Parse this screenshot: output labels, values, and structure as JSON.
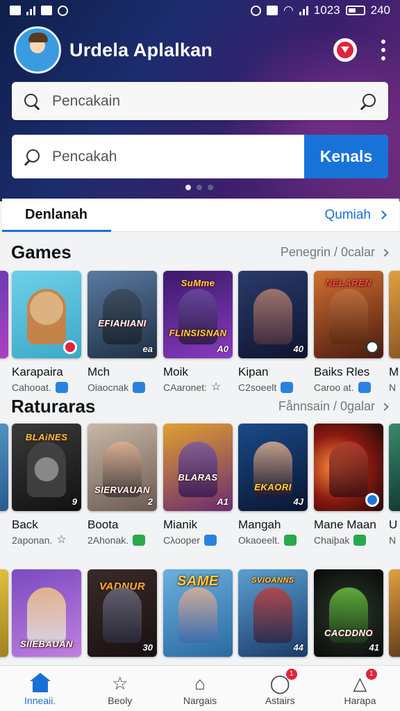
{
  "status": {
    "time": "240",
    "battery_text": "1023"
  },
  "header": {
    "title": "Urdela Aplalkan"
  },
  "search_primary": {
    "placeholder": "Pencakain"
  },
  "search_secondary": {
    "placeholder": "Pencakah",
    "button_label": "Kenals"
  },
  "tabs": {
    "active": "Denlanah",
    "link": "Qumiah"
  },
  "sections": [
    {
      "title": "Games",
      "more": "Penegrin / 0calar",
      "items": [
        {
          "name": "Karapaira",
          "meta": "Cahooat.",
          "cap": "",
          "badge": "",
          "icon": "blue"
        },
        {
          "name": "Mch",
          "meta": "Oiaocnak",
          "cap": "EFIAHIANI",
          "badge": "ea",
          "icon": "blue"
        },
        {
          "name": "Moik",
          "meta": "CAaronet:",
          "cap": "FLINSISNAN",
          "badge": "A0",
          "icon": "star",
          "title_top": "SuMme"
        },
        {
          "name": "Kipan",
          "meta": "C2soeelt",
          "cap": "",
          "badge": "40",
          "icon": "blue"
        },
        {
          "name": "Baiks Rles",
          "meta": "Caroo at.",
          "cap": "",
          "badge": "",
          "icon": "blue",
          "title_top": "NELAREN"
        }
      ],
      "partial_right": {
        "name": "M",
        "meta": "N"
      }
    },
    {
      "title": "Raturaras",
      "more": "Fånnsain / 0galar",
      "items": [
        {
          "name": "Back",
          "meta": "2aponan.",
          "cap": "",
          "badge": "9",
          "icon": "star",
          "title_top": "BLAiNES"
        },
        {
          "name": "Boota",
          "meta": "2Ahonak.",
          "cap": "SIERVAUAN",
          "badge": "2",
          "icon": "green"
        },
        {
          "name": "Mianik",
          "meta": "Cλooper",
          "cap": "BLARAS",
          "badge": "A1",
          "icon": "blue"
        },
        {
          "name": "Mangah",
          "meta": "Okaoeelt.",
          "cap": "EKAORI",
          "badge": "4J",
          "icon": "green"
        },
        {
          "name": "Mane Maan",
          "meta": "Chaiþak",
          "cap": "",
          "badge": "",
          "icon": "green"
        }
      ],
      "partial_right": {
        "name": "U",
        "meta": "N"
      }
    },
    {
      "items": [
        {
          "cap": "SIIEBAUAN",
          "badge": "",
          "title_top": ""
        },
        {
          "cap": "",
          "badge": "30",
          "title_top": "VADNUR"
        },
        {
          "cap": "",
          "badge": "",
          "title_top": "SAME"
        },
        {
          "cap": "",
          "badge": "44",
          "title_top": "SVIOANNS"
        },
        {
          "cap": "CACDDNO",
          "badge": "41",
          "title_top": ""
        }
      ]
    }
  ],
  "bottom_nav": [
    {
      "label": "Inneaii.",
      "active": true
    },
    {
      "label": "Beoly",
      "active": false
    },
    {
      "label": "Nargais",
      "active": false
    },
    {
      "label": "Astairs",
      "active": false,
      "badge": "1"
    },
    {
      "label": "Harapa",
      "active": false,
      "badge": "1"
    }
  ],
  "colors": {
    "accent": "#1a6fd4",
    "button": "#1873d9",
    "badge_red": "#e0243a"
  }
}
